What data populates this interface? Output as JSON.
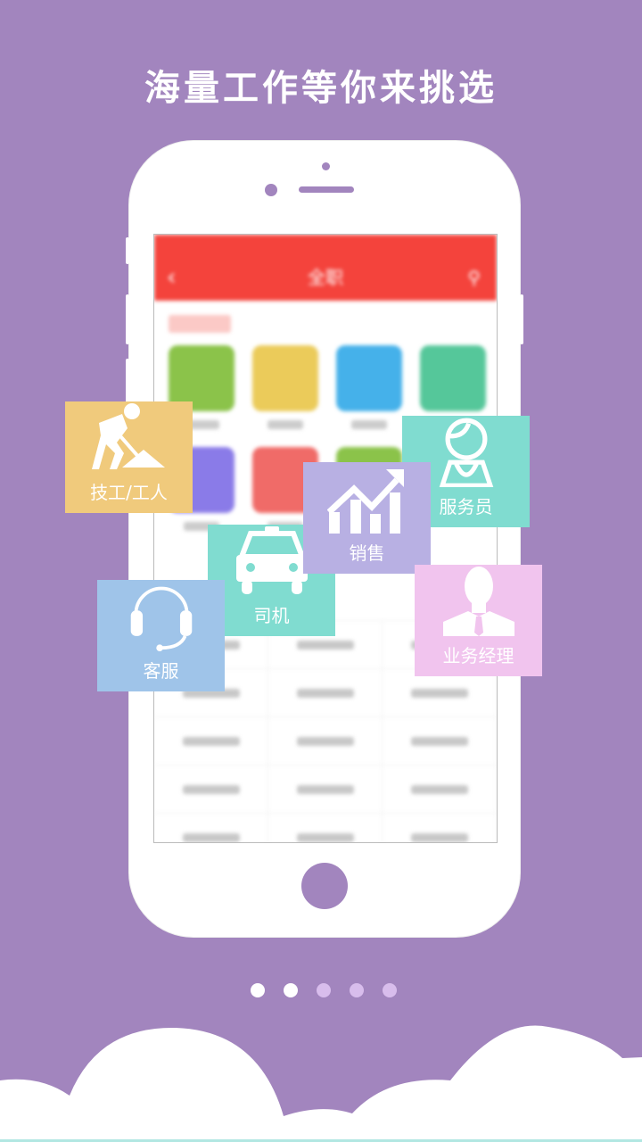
{
  "headline": "海量工作等你来挑选",
  "phone_screen": {
    "nav_title": "全职",
    "back_icon": "chevron-left-icon",
    "search_icon": "search-icon",
    "category_colors": [
      "#8BC34A",
      "#EBCB5A",
      "#45B1EA",
      "#55C79A",
      "#8A7BE8",
      "#F06B68",
      "#8BC34A"
    ]
  },
  "tiles": [
    {
      "label": "服务员",
      "icon": "waitress-icon",
      "color": "#80DCD0"
    },
    {
      "label": "司机",
      "icon": "taxi-icon",
      "color": "#80DCD0"
    },
    {
      "label": "销售",
      "icon": "sales-chart-icon",
      "color": "#B8B0E3"
    },
    {
      "label": "客服",
      "icon": "headset-icon",
      "color": "#9FC4E9"
    },
    {
      "label": "技工/工人",
      "icon": "worker-shovel-icon",
      "color": "#F0CA7C"
    },
    {
      "label": "业务经理",
      "icon": "businessman-icon",
      "color": "#F1C4EE"
    }
  ],
  "pagination": {
    "total": 5,
    "active": [
      0,
      1
    ],
    "active_color": "#FFFFFF",
    "inactive_color": "#D8BDEC"
  },
  "colors": {
    "background": "#A285BE",
    "phone": "#FFFFFF",
    "accent_red": "#F4433C"
  }
}
